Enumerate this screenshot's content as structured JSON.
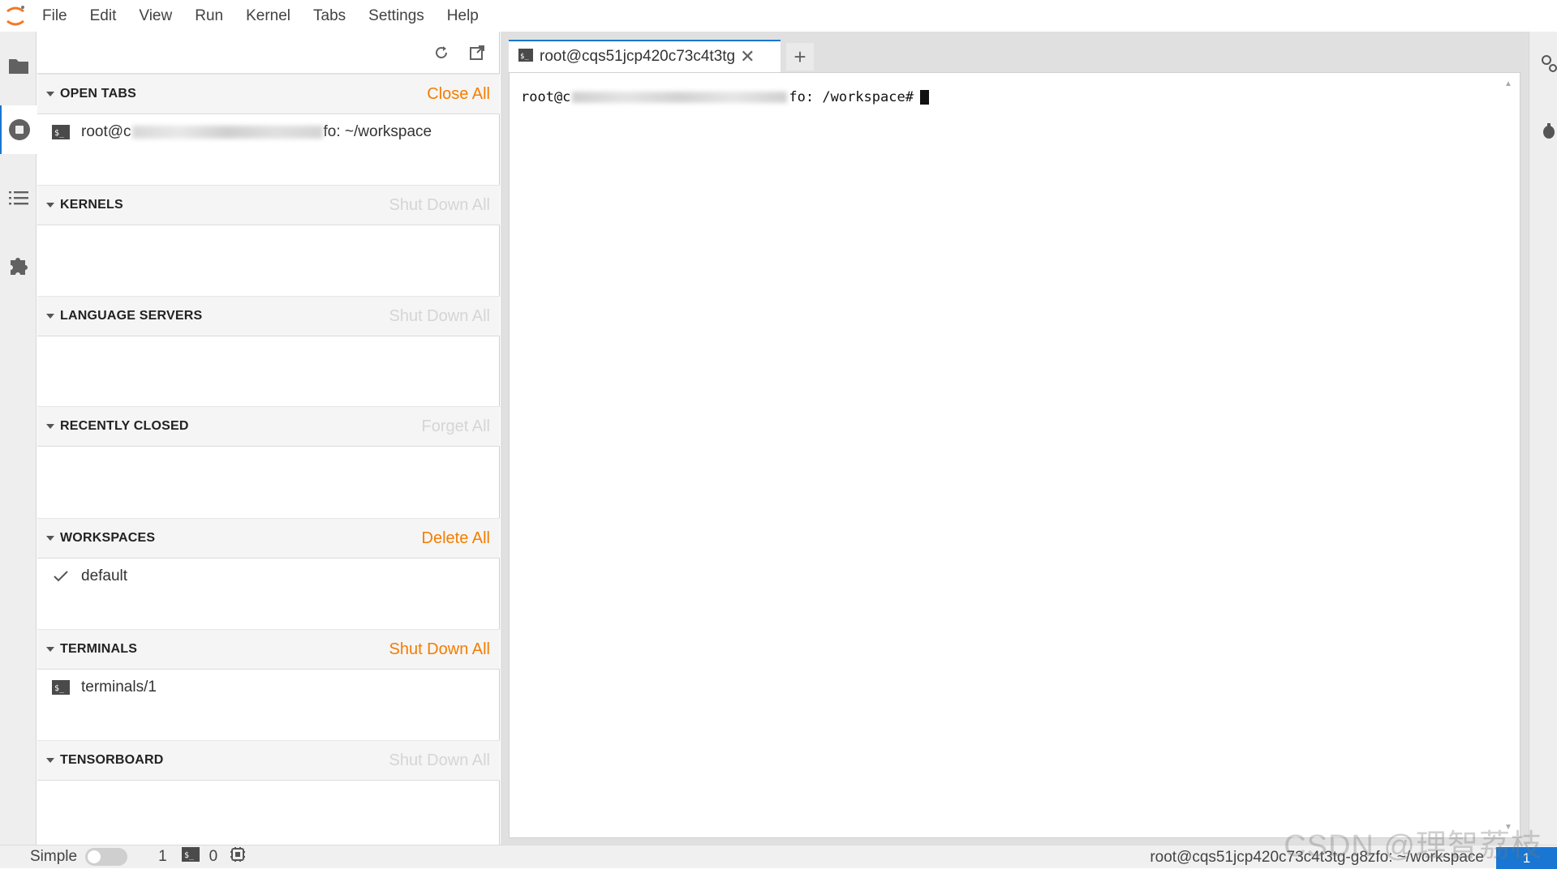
{
  "menubar": {
    "items": [
      "File",
      "Edit",
      "View",
      "Run",
      "Kernel",
      "Tabs",
      "Settings",
      "Help"
    ]
  },
  "activitybar": {
    "icons": [
      "folder-icon",
      "stop-circle-icon",
      "list-icon",
      "puzzle-icon"
    ]
  },
  "sidepanel": {
    "sections": [
      {
        "title": "OPEN TABS",
        "action": "Close All",
        "action_state": "active",
        "rows": [
          {
            "icon": "terminal-icon",
            "text_prefix": "root@c",
            "text_suffix": "fo: ~/workspace"
          }
        ]
      },
      {
        "title": "KERNELS",
        "action": "Shut Down All",
        "action_state": "disabled",
        "rows": []
      },
      {
        "title": "LANGUAGE SERVERS",
        "action": "Shut Down All",
        "action_state": "disabled",
        "rows": []
      },
      {
        "title": "RECENTLY CLOSED",
        "action": "Forget All",
        "action_state": "disabled",
        "rows": []
      },
      {
        "title": "WORKSPACES",
        "action": "Delete All",
        "action_state": "active",
        "rows": [
          {
            "icon": "check-icon",
            "text": "default"
          }
        ]
      },
      {
        "title": "TERMINALS",
        "action": "Shut Down All",
        "action_state": "active",
        "rows": [
          {
            "icon": "terminal-icon",
            "text": "terminals/1"
          }
        ]
      },
      {
        "title": "TENSORBOARD",
        "action": "Shut Down All",
        "action_state": "disabled",
        "rows": []
      }
    ]
  },
  "main": {
    "tab_label": "root@cqs51jcp420c73c4t3tg",
    "tab_close": "✕",
    "new_tab": "+",
    "terminal": {
      "prompt_prefix": "root@c",
      "prompt_suffix": "fo: /workspace#"
    }
  },
  "statusbar": {
    "mode_label": "Simple",
    "count_1": "1",
    "count_2": "0",
    "right_text": "root@cqs51jcp420c73c4t3tg-g8zfo: ~/workspace",
    "badge": "1"
  },
  "watermark": "CSDN @理智荔枝",
  "colors": {
    "accent": "#1976d2",
    "action_active": "#f57c00",
    "action_disabled": "#d5d5d5"
  }
}
